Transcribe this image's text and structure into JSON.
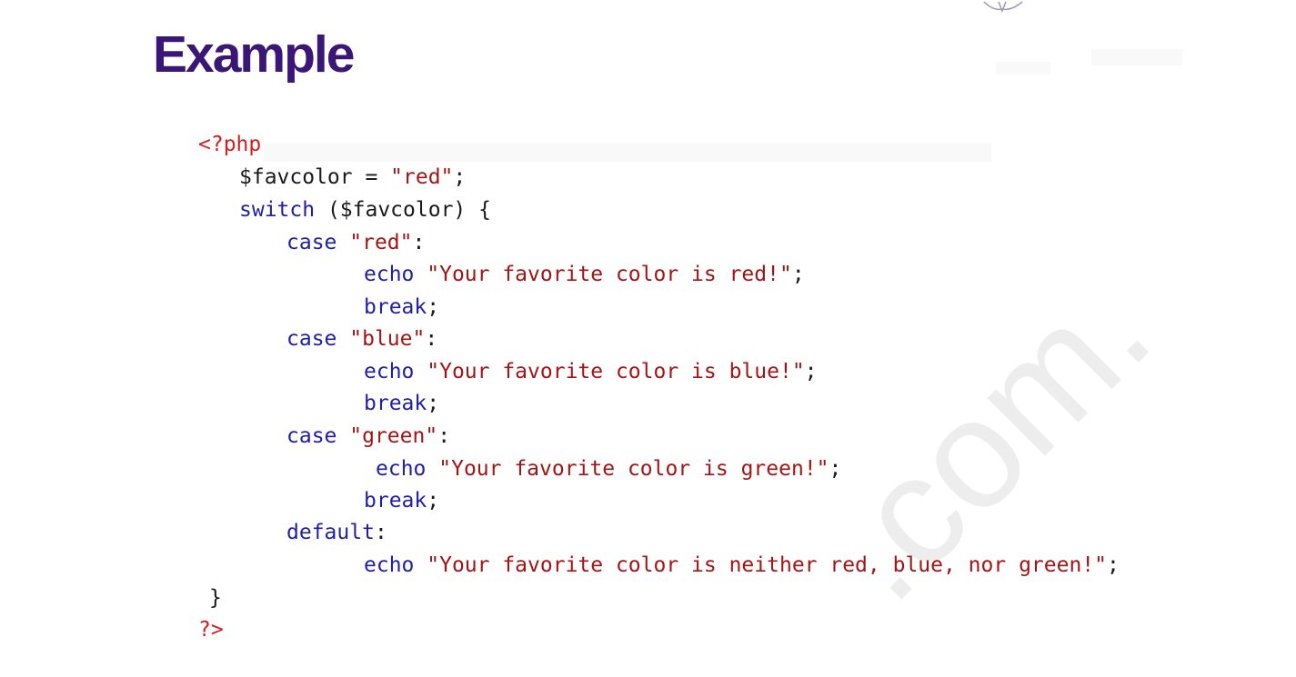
{
  "slide": {
    "title": "Example"
  },
  "code": {
    "l1": {
      "open_tag": "<?php"
    },
    "l2": {
      "var": "$favcolor",
      "op": " = ",
      "str": "\"red\"",
      "end": ";"
    },
    "l3": {
      "kw": "switch",
      "rest": " ($favcolor) {"
    },
    "l4": {
      "kw": "case",
      "sp": " ",
      "str": "\"red\"",
      "end": ":"
    },
    "l5": {
      "kw": "echo",
      "sp": " ",
      "str": "\"Your favorite color is red!\"",
      "end": ";"
    },
    "l6": {
      "kw": "break",
      "end": ";"
    },
    "l7": {
      "kw": "case",
      "sp": " ",
      "str": "\"blue\"",
      "end": ":"
    },
    "l8": {
      "kw": "echo",
      "sp": " ",
      "str": "\"Your favorite color is blue!\"",
      "end": ";"
    },
    "l9": {
      "kw": "break",
      "end": ";"
    },
    "l10": {
      "kw": "case",
      "sp": " ",
      "str": "\"green\"",
      "end": ":"
    },
    "l11": {
      "kw": "echo",
      "sp": " ",
      "str": "\"Your favorite color is green!\"",
      "end": ";"
    },
    "l12": {
      "kw": "break",
      "end": ";"
    },
    "l13": {
      "kw": "default",
      "end": ":"
    },
    "l14": {
      "kw": "echo",
      "sp": " ",
      "str": "\"Your favorite color is neither red, blue, nor green!\"",
      "end": ";"
    },
    "l15": {
      "brace": "}"
    },
    "l16": {
      "close_tag": "?>"
    }
  },
  "colors": {
    "title": "#3a1677",
    "keyword": "#1f1fa8",
    "string": "#a31515",
    "php_tag": "#d02020",
    "plain": "#1a1a1a"
  },
  "watermark": {
    "text": ".com."
  }
}
